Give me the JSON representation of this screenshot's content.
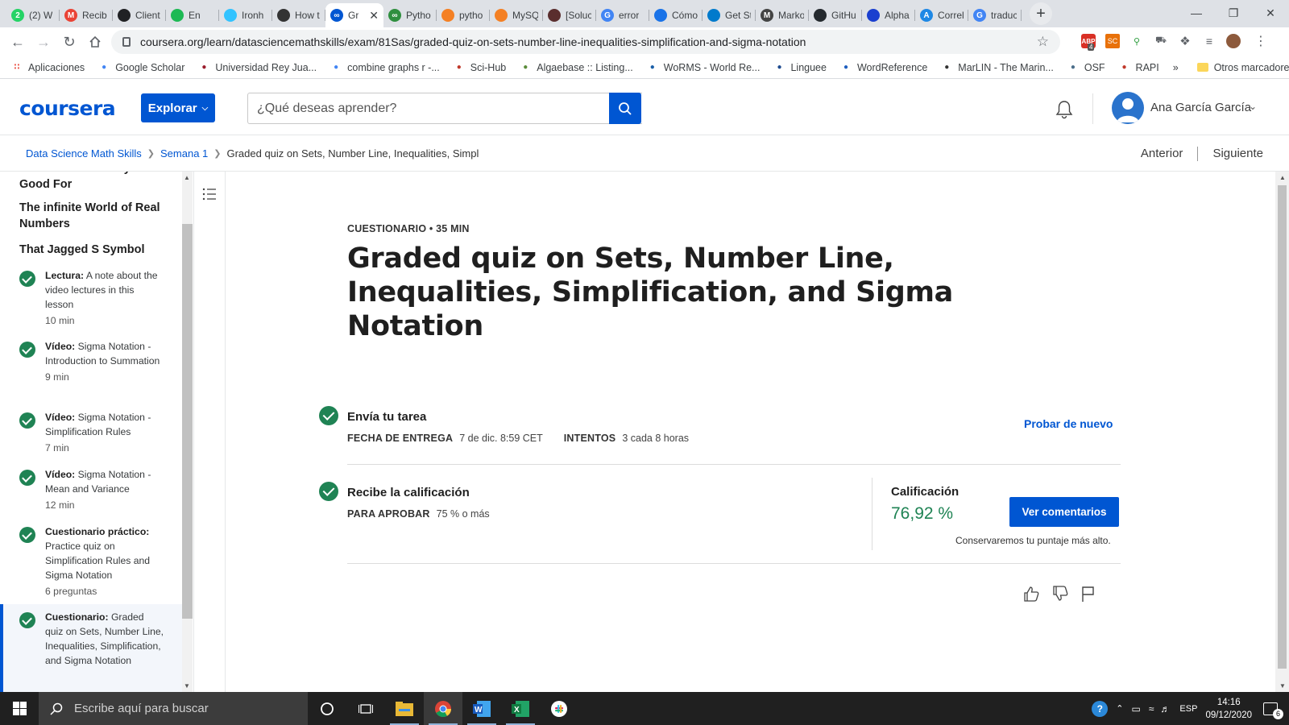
{
  "browser": {
    "tabs": [
      {
        "title": "(2) W",
        "icon": "whatsapp-icon",
        "color": "#25d366",
        "glyph": "2"
      },
      {
        "title": "Recib",
        "icon": "gmail-icon",
        "color": "#ea4335",
        "glyph": "M"
      },
      {
        "title": "Client",
        "icon": "client-icon",
        "color": "#202124",
        "glyph": ""
      },
      {
        "title": "En",
        "icon": "spotify-icon",
        "color": "#1db954",
        "glyph": ""
      },
      {
        "title": "Ironh",
        "icon": "ironhack-icon",
        "color": "#32c3ff",
        "glyph": ""
      },
      {
        "title": "How t",
        "icon": "hexagon-icon",
        "color": "#333333",
        "glyph": ""
      },
      {
        "title": "Gr",
        "icon": "coursera-icon",
        "color": "#0056d2",
        "glyph": "∞",
        "active": true
      },
      {
        "title": "Pytho",
        "icon": "python-icon",
        "color": "#2f8f3f",
        "glyph": "∞"
      },
      {
        "title": "pytho",
        "icon": "stackoverflow-icon",
        "color": "#f48024",
        "glyph": ""
      },
      {
        "title": "MySQ",
        "icon": "stackoverflow-icon",
        "color": "#f48024",
        "glyph": ""
      },
      {
        "title": "[Soluc",
        "icon": "doc-icon",
        "color": "#5a2e2e",
        "glyph": ""
      },
      {
        "title": "error",
        "icon": "google-icon",
        "color": "#4285f4",
        "glyph": "G"
      },
      {
        "title": "Cómo",
        "icon": "refresh-icon",
        "color": "#1a73e8",
        "glyph": ""
      },
      {
        "title": "Get St",
        "icon": "vscode-icon",
        "color": "#007acc",
        "glyph": ""
      },
      {
        "title": "Marko",
        "icon": "markdown-icon",
        "color": "#444444",
        "glyph": "M"
      },
      {
        "title": "GitHu",
        "icon": "github-icon",
        "color": "#24292e",
        "glyph": ""
      },
      {
        "title": "Alpha",
        "icon": "alpha-icon",
        "color": "#1a3fcf",
        "glyph": ""
      },
      {
        "title": "Correl",
        "icon": "a-icon",
        "color": "#1e88e5",
        "glyph": "A"
      },
      {
        "title": "traduc",
        "icon": "google-icon",
        "color": "#4285f4",
        "glyph": "G"
      }
    ],
    "url": "coursera.org/learn/datasciencemathskills/exam/81Sas/graded-quiz-on-sets-number-line-inequalities-simplification-and-sigma-notation",
    "extension_badge": "4",
    "bookmarks": [
      {
        "label": "Aplicaciones",
        "icon": "apps-grid-icon"
      },
      {
        "label": "Google Scholar",
        "icon": "scholar-icon"
      },
      {
        "label": "Universidad Rey Jua...",
        "icon": "urjc-icon"
      },
      {
        "label": "combine graphs r -...",
        "icon": "google-icon"
      },
      {
        "label": "Sci-Hub",
        "icon": "scihub-icon"
      },
      {
        "label": "Algaebase :: Listing...",
        "icon": "algaebase-icon"
      },
      {
        "label": "WoRMS - World Re...",
        "icon": "worms-icon"
      },
      {
        "label": "Linguee",
        "icon": "linguee-icon"
      },
      {
        "label": "WordReference",
        "icon": "wordreference-icon"
      },
      {
        "label": "MarLIN - The Marin...",
        "icon": "marlin-icon"
      },
      {
        "label": "OSF",
        "icon": "osf-icon"
      },
      {
        "label": "RAPI",
        "icon": "rapi-icon"
      }
    ],
    "more_bookmarks": "»",
    "other_bookmarks": "Otros marcadores"
  },
  "header": {
    "logo": "coursera",
    "explore": "Explorar",
    "search_placeholder": "¿Qué deseas aprender?",
    "user_name": "Ana García García"
  },
  "breadcrumb": {
    "course": "Data Science Math Skills",
    "week": "Semana 1",
    "current": "Graded quiz on Sets, Number Line, Inequalities, Simpl",
    "prev": "Anterior",
    "next": "Siguiente"
  },
  "sidebar": {
    "headings": [
      "Sets and What They're Good For",
      "The infinite World of Real Numbers",
      "That Jagged S Symbol"
    ],
    "items": [
      {
        "type": "Lectura:",
        "name": "A note about the video lectures in this lesson",
        "meta": "10 min"
      },
      {
        "type": "Vídeo:",
        "name": "Sigma Notation - Introduction to Summation",
        "meta": "9 min"
      },
      {
        "type": "Vídeo:",
        "name": "Sigma Notation - Simplification Rules",
        "meta": "7 min"
      },
      {
        "type": "Vídeo:",
        "name": "Sigma Notation - Mean and Variance",
        "meta": "12 min"
      },
      {
        "type": "Cuestionario práctico:",
        "name": "Practice quiz on Simplification Rules and Sigma Notation",
        "meta": "6 preguntas"
      },
      {
        "type": "Cuestionario:",
        "name": "Graded quiz on Sets, Number Line, Inequalities, Simplification, and Sigma Notation",
        "meta": ""
      }
    ]
  },
  "main": {
    "kicker": "CUESTIONARIO • 35 MIN",
    "title": "Graded quiz on Sets, Number Line, Inequalities, Simplification, and Sigma Notation",
    "submit": {
      "title": "Envía tu tarea",
      "due_label": "FECHA DE ENTREGA",
      "due_value": "7 de dic. 8:59 CET",
      "attempts_label": "INTENTOS",
      "attempts_value": "3 cada 8 horas",
      "retry": "Probar de nuevo"
    },
    "grade": {
      "title": "Recibe la calificación",
      "pass_label": "PARA APROBAR",
      "pass_value": "75 % o más",
      "grade_label": "Calificación",
      "grade_value": "76,92 %",
      "feedback_button": "Ver comentarios",
      "keep_note": "Conservaremos tu puntaje más alto."
    }
  },
  "taskbar": {
    "search_placeholder": "Escribe aquí para buscar",
    "language": "ESP",
    "time": "14:16",
    "date": "09/12/2020",
    "notifications": "6"
  },
  "colors": {
    "accent": "#0056d2",
    "success": "#1f8354"
  }
}
